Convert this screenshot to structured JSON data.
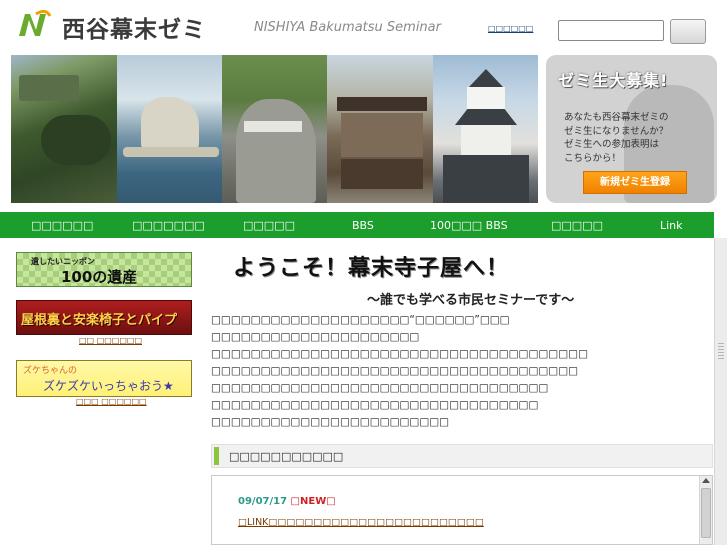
{
  "header": {
    "logo_text": "西谷幕末ゼミ",
    "logo_subtitle": "NISHIYA Bakumatsu Seminar",
    "top_link": "□□□□□□",
    "search": {
      "value": "",
      "placeholder": ""
    },
    "search_button_label": ""
  },
  "recruit": {
    "title": "ゼミ生大募集!",
    "body": [
      "あなたも西谷幕末ゼミの",
      "ゼミ生になりませんか？",
      "ゼミ生への参加表明は",
      "こちらから！"
    ],
    "button_label": "新規ゼミ生登録"
  },
  "nav": {
    "items": [
      {
        "label": "□□□□□□"
      },
      {
        "label": "□□□□□□□"
      },
      {
        "label": "□□□□□"
      },
      {
        "label": "BBS"
      },
      {
        "label": "100□□□ BBS"
      },
      {
        "label": "□□□□□"
      },
      {
        "label": "Link"
      }
    ]
  },
  "sidebar": {
    "heritage_small": "遺したいニッポン",
    "heritage_big": "100の遺産",
    "pipe_banner": "屋根裏と安楽椅子とパイプ",
    "pipe_link": "□□ □□□□□□",
    "zuke_line1": "ズケちゃんの",
    "zuke_line2": "ズケズケいっちゃおう★",
    "zuke_link": "□□□ □□□□□□"
  },
  "main": {
    "welcome": "ようこそ！幕末寺子屋へ！",
    "subtitle": "～誰でも学べる市民セミナーです～",
    "intro": [
      "□□□□□□□□□□□□□□□□□□□□“□□□□□□”□□□",
      "□□□□□□□□□□□□□□□□□□□□□",
      "□□□□□□□□□□□□□□□□□□□□□□□□□□□□□□□□□□□□□□",
      "□□□□□□□□□□□□□□□□□□□□□□□□□□□□□□□□□□□□□",
      "□□□□□□□□□□□□□□□□□□□□□□□□□□□□□□□□□□",
      "□□□□□□□□□□□□□□□□□□□□□□□□□□□□□□□□□",
      "□□□□□□□□□□□□□□□□□□□□□□□□"
    ],
    "news_header": "□□□□□□□□□□□",
    "news": {
      "date": "09/07/17 ",
      "new_badge": "□NEW□",
      "link": "□LINK□□□□□□□□□□□□□□□□□□□□□□□□"
    }
  },
  "colors": {
    "nav_green": "#1c9e2c",
    "accent_orange": "#f08200",
    "news_date": "#2a9a8a"
  }
}
